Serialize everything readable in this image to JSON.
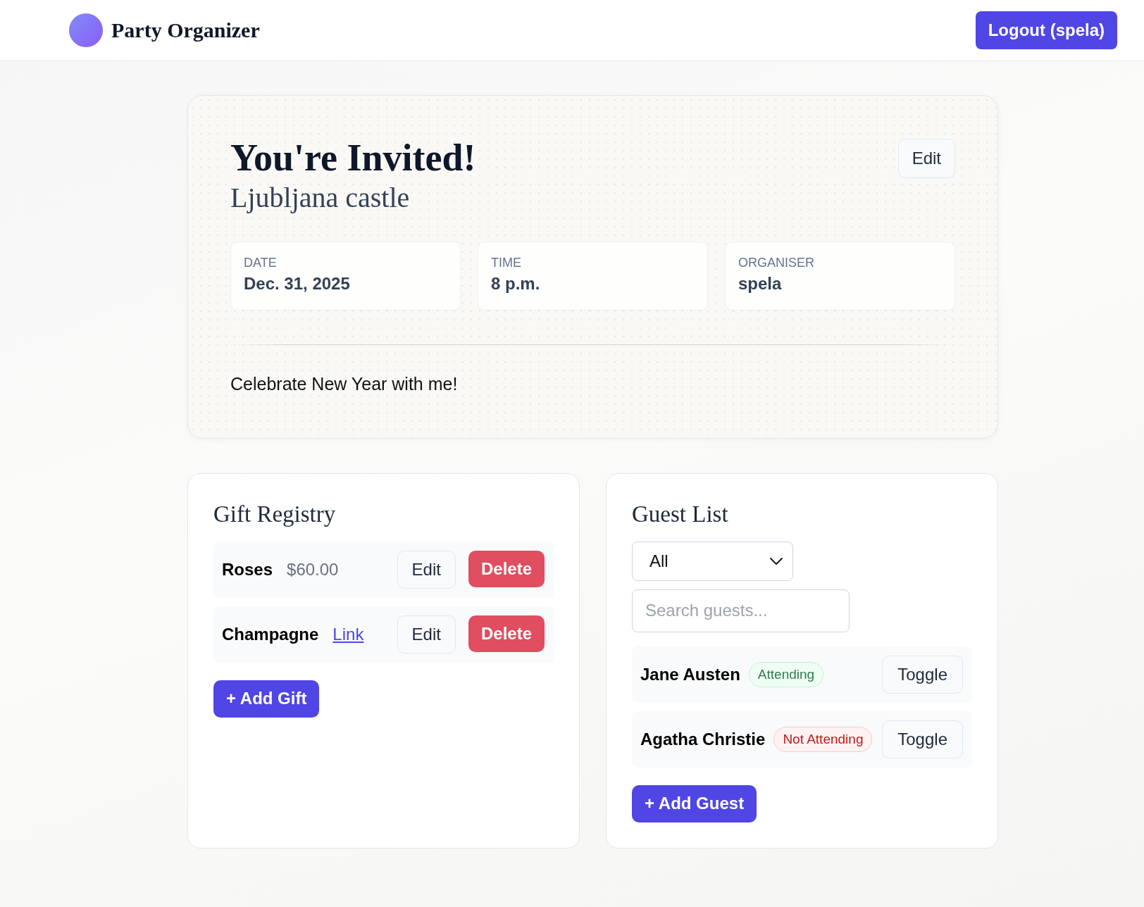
{
  "header": {
    "title": "Party Organizer",
    "logout_button": "Logout (spela)"
  },
  "invitation": {
    "title": "You're Invited!",
    "location": "Ljubljana castle",
    "edit_button": "Edit",
    "details": [
      {
        "label": "DATE",
        "value": "Dec. 31, 2025"
      },
      {
        "label": "TIME",
        "value": "8 p.m."
      },
      {
        "label": "ORGANISER",
        "value": "spela"
      }
    ],
    "description": "Celebrate New Year with me!"
  },
  "gift_registry": {
    "title": "Gift Registry",
    "gifts": [
      {
        "name": "Roses",
        "kind": "price",
        "detail": "$60.00",
        "edit_button": "Edit",
        "delete_button": "Delete"
      },
      {
        "name": "Champagne",
        "kind": "link",
        "detail": "Link",
        "edit_button": "Edit",
        "delete_button": "Delete"
      }
    ],
    "add_button": "+ Add Gift"
  },
  "guest_list": {
    "title": "Guest List",
    "filter": {
      "value": "All"
    },
    "search": {
      "placeholder": "Search guests..."
    },
    "guests": [
      {
        "name": "Jane Austen",
        "attending": true,
        "status": "Attending",
        "toggle_button": "Toggle"
      },
      {
        "name": "Agatha Christie",
        "attending": false,
        "status": "Not Attending",
        "toggle_button": "Toggle"
      }
    ],
    "add_button": "+ Add Guest"
  }
}
